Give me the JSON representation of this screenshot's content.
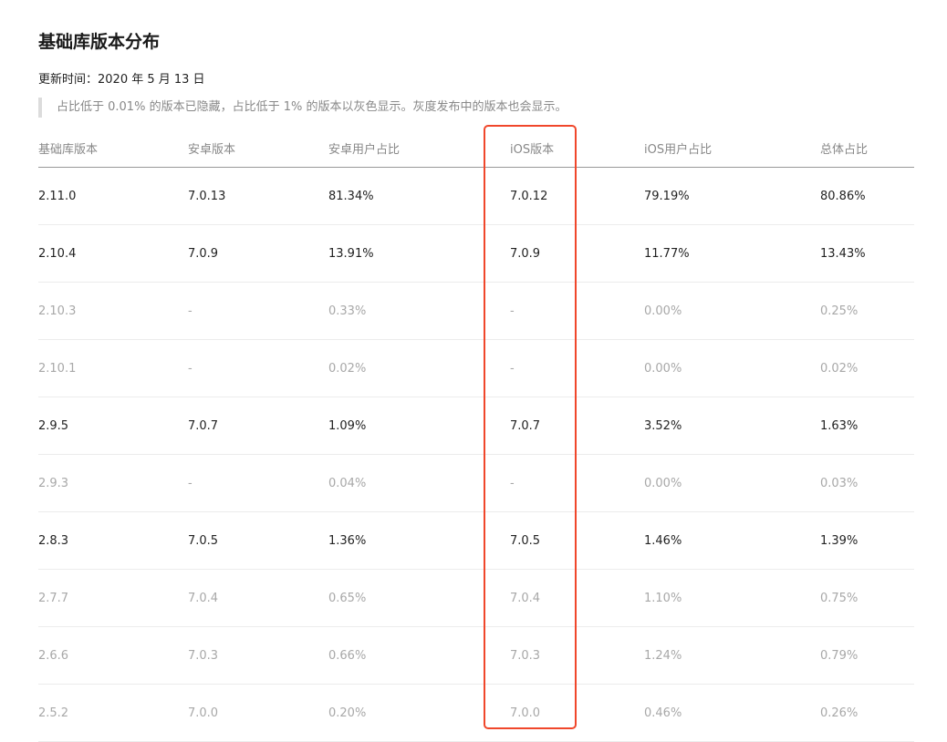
{
  "page": {
    "title": "基础库版本分布",
    "update_time": "更新时间：2020 年 5 月 13 日",
    "note": "占比低于 0.01% 的版本已隐藏，占比低于 1% 的版本以灰色显示。灰度发布中的版本也会显示。"
  },
  "table": {
    "headers": [
      "基础库版本",
      "安卓版本",
      "安卓用户占比",
      "iOS版本",
      "iOS用户占比",
      "总体占比"
    ],
    "rows": [
      {
        "gray": false,
        "cells": [
          "2.11.0",
          "7.0.13",
          "81.34%",
          "7.0.12",
          "79.19%",
          "80.86%"
        ]
      },
      {
        "gray": false,
        "cells": [
          "2.10.4",
          "7.0.9",
          "13.91%",
          "7.0.9",
          "11.77%",
          "13.43%"
        ]
      },
      {
        "gray": true,
        "cells": [
          "2.10.3",
          "-",
          "0.33%",
          "-",
          "0.00%",
          "0.25%"
        ]
      },
      {
        "gray": true,
        "cells": [
          "2.10.1",
          "-",
          "0.02%",
          "-",
          "0.00%",
          "0.02%"
        ]
      },
      {
        "gray": false,
        "cells": [
          "2.9.5",
          "7.0.7",
          "1.09%",
          "7.0.7",
          "3.52%",
          "1.63%"
        ]
      },
      {
        "gray": true,
        "cells": [
          "2.9.3",
          "-",
          "0.04%",
          "-",
          "0.00%",
          "0.03%"
        ]
      },
      {
        "gray": false,
        "cells": [
          "2.8.3",
          "7.0.5",
          "1.36%",
          "7.0.5",
          "1.46%",
          "1.39%"
        ]
      },
      {
        "gray": true,
        "cells": [
          "2.7.7",
          "7.0.4",
          "0.65%",
          "7.0.4",
          "1.10%",
          "0.75%"
        ]
      },
      {
        "gray": true,
        "cells": [
          "2.6.6",
          "7.0.3",
          "0.66%",
          "7.0.3",
          "1.24%",
          "0.79%"
        ]
      },
      {
        "gray": true,
        "cells": [
          "2.5.2",
          "7.0.0",
          "0.20%",
          "7.0.0",
          "0.46%",
          "0.26%"
        ]
      }
    ]
  },
  "colors": {
    "highlight_border": "#f0472b",
    "gray_text": "#a8a8a8",
    "note_bar": "#dcdcdc"
  }
}
